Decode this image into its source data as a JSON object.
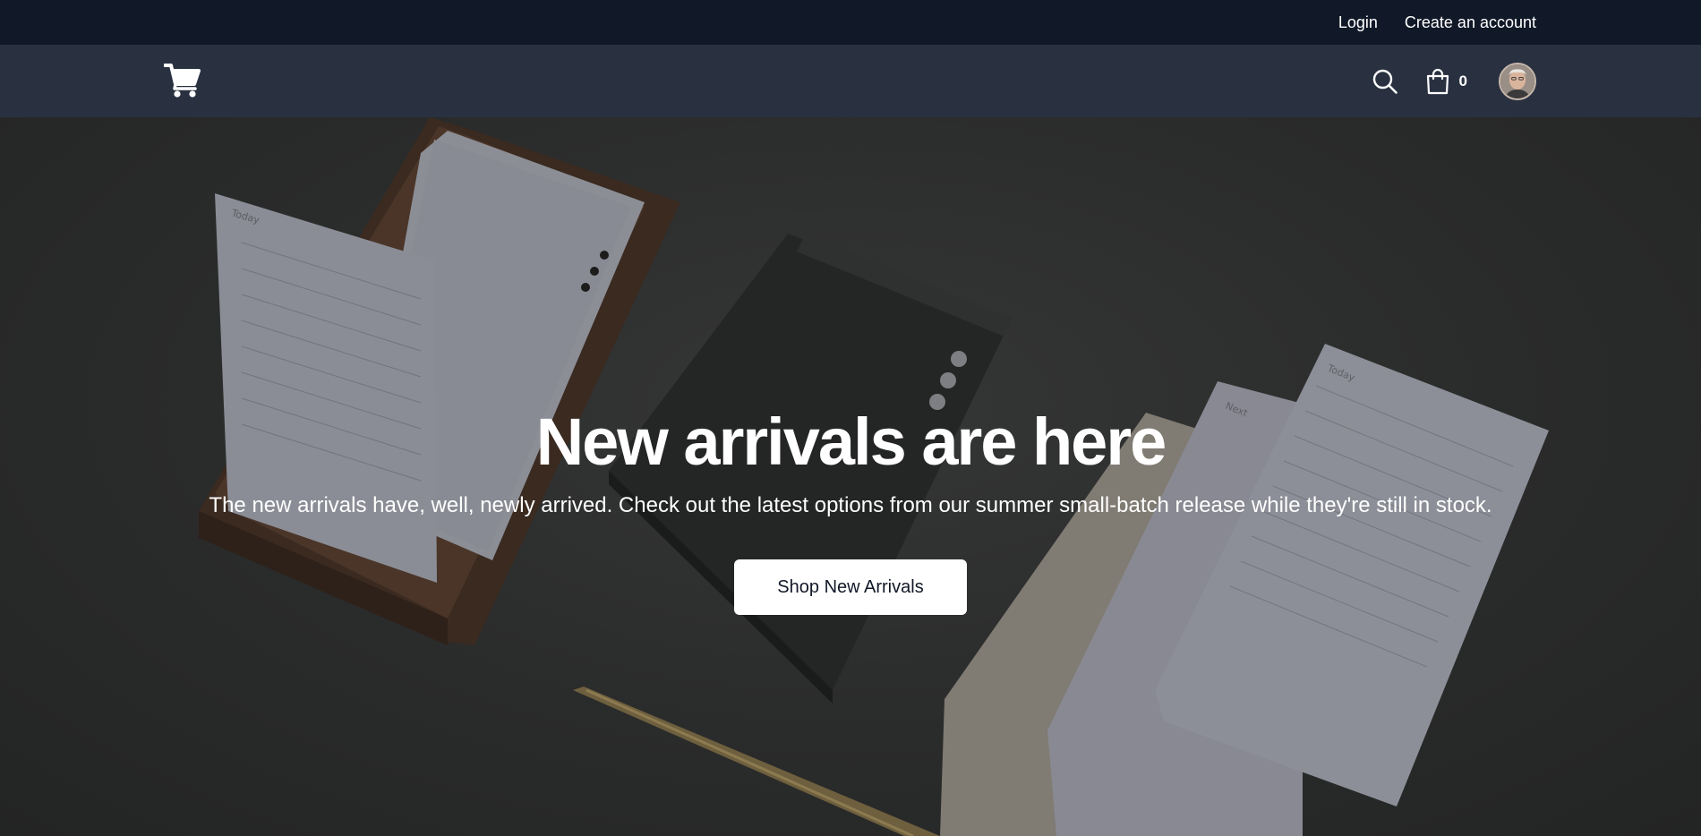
{
  "topbar": {
    "login": "Login",
    "create_account": "Create an account"
  },
  "nav": {
    "logo_icon": "shopping-cart-icon",
    "search_icon": "search-icon",
    "bag_icon": "shopping-bag-icon",
    "bag_count": "0"
  },
  "hero": {
    "title": "New arrivals are here",
    "subtitle": "The new arrivals have, well, newly arrived. Check out the latest options from our summer small-batch release while they're still in stock.",
    "cta": "Shop New Arrivals",
    "card_labels": {
      "left": "Today",
      "next": "Next",
      "right": "Today"
    }
  },
  "colors": {
    "topbar_bg": "#111827",
    "navbar_bg": "#293141",
    "hero_bg": "#2b2c2c"
  }
}
